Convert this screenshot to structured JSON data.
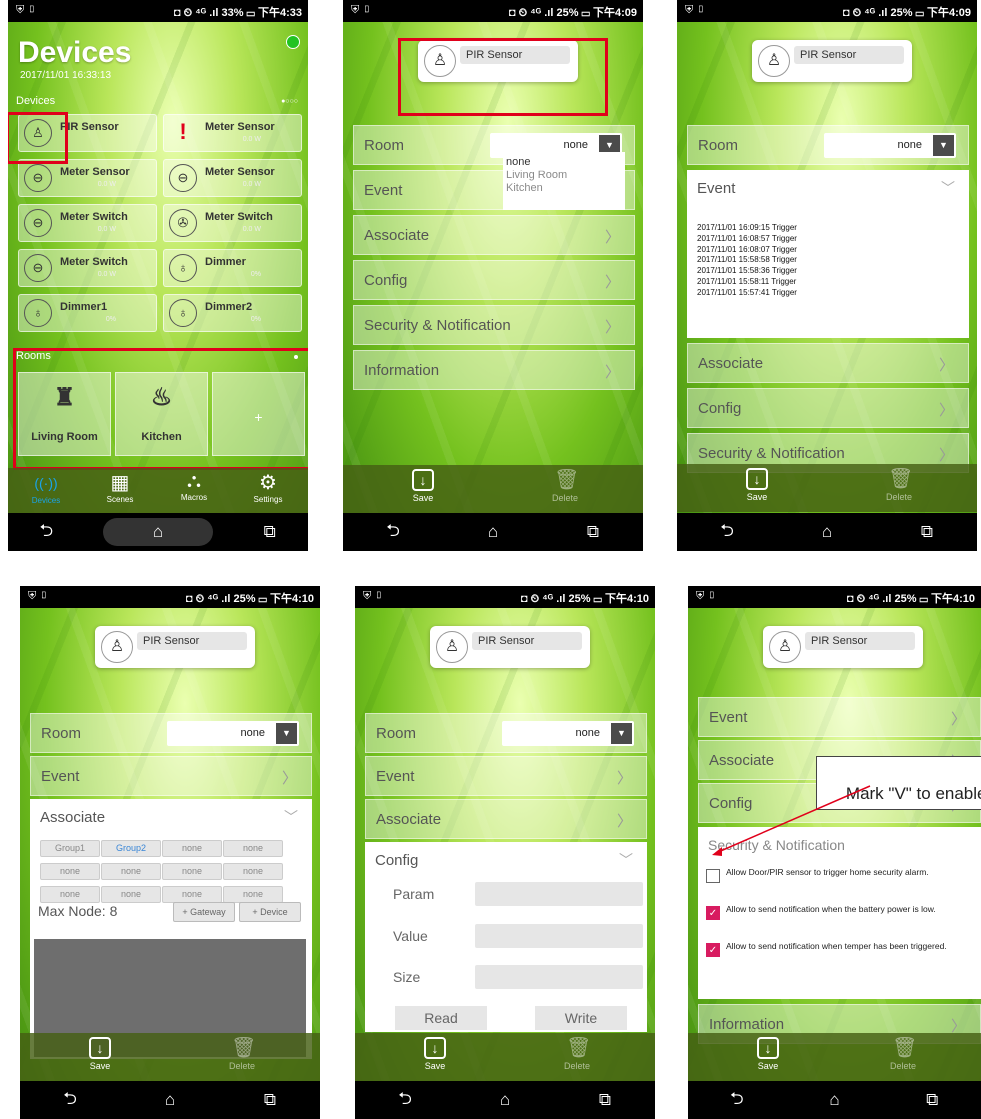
{
  "status": {
    "left_icons": "⛨ ▯",
    "s1": "◘ ⏲ ⁴ᴳ .ıl 33% ▭ 下午4:33",
    "s2": "◘ ⏲ ⁴ᴳ .ıl 25% ▭ 下午4:09",
    "s3": "◘ ⏲ ⁴ᴳ .ıl 25% ▭ 下午4:09",
    "s4": "◘ ⏲ ⁴ᴳ .ıl 25% ▭ 下午4:10",
    "s5": "◘ ⏲ ⁴ᴳ .ıl 25% ▭ 下午4:10",
    "s6": "◘ ⏲ ⁴ᴳ .ıl 25% ▭ 下午4:10"
  },
  "nav": {
    "back": "⮌",
    "home": "⌂",
    "recent": "⧉"
  },
  "screen1": {
    "title": "Devices",
    "datetime": "2017/11/01 16:33:13",
    "devices_label": "Devices",
    "page_dots": "●○○○",
    "devices": [
      {
        "name": "PIR Sensor",
        "value": "",
        "icon": "person-icon"
      },
      {
        "name": "Meter Sensor",
        "value": "0.0 W",
        "icon": "alert-icon"
      },
      {
        "name": "Meter Sensor",
        "value": "0.0 W",
        "icon": "meter-icon"
      },
      {
        "name": "Meter Sensor",
        "value": "0.0 W",
        "icon": "meter-icon"
      },
      {
        "name": "Meter Switch",
        "value": "0.0 W",
        "icon": "meter-switch-icon"
      },
      {
        "name": "Meter Switch",
        "value": "0.0 W",
        "icon": "fan-icon"
      },
      {
        "name": "Meter Switch",
        "value": "0.0 W",
        "icon": "meter-switch-icon"
      },
      {
        "name": "Dimmer",
        "value": "0%",
        "icon": "bulb-icon"
      },
      {
        "name": "Dimmer1",
        "value": "0%",
        "icon": "bulb-icon"
      },
      {
        "name": "Dimmer2",
        "value": "0%",
        "icon": "bulb-icon"
      }
    ],
    "rooms_label": "Rooms",
    "rooms": [
      {
        "name": "Living Room",
        "icon": "living-room-icon"
      },
      {
        "name": "Kitchen",
        "icon": "kitchen-icon"
      },
      {
        "name": "+",
        "icon": "add-icon"
      }
    ],
    "tabs": [
      {
        "label": "Devices",
        "icon": "wifi-person-icon"
      },
      {
        "label": "Scenes",
        "icon": "clapper-icon"
      },
      {
        "label": "Macros",
        "icon": "macro-icon"
      },
      {
        "label": "Settings",
        "icon": "gear-icon"
      }
    ]
  },
  "detail": {
    "device_name": "PIR Sensor",
    "room_label": "Room",
    "room_value": "none",
    "event_label": "Event",
    "associate_label": "Associate",
    "config_label": "Config",
    "security_label": "Security & Notification",
    "information_label": "Information",
    "save_label": "Save",
    "delete_label": "Delete"
  },
  "screen2": {
    "room_options": [
      "none",
      "Living Room",
      "Kitchen"
    ]
  },
  "screen3": {
    "events": [
      "2017/11/01 16:09:15 Trigger",
      "2017/11/01 16:08:57 Trigger",
      "2017/11/01 16:08:07 Trigger",
      "2017/11/01 15:58:58 Trigger",
      "2017/11/01 15:58:36 Trigger",
      "2017/11/01 15:58:11 Trigger",
      "2017/11/01 15:57:41 Trigger"
    ]
  },
  "screen4": {
    "groups": [
      "Group1",
      "Group2",
      "none",
      "none",
      "none",
      "none",
      "none",
      "none",
      "none",
      "none",
      "none",
      "none"
    ],
    "max_node": "Max Node: 8",
    "gateway_btn": "+ Gateway",
    "device_btn": "+ Device"
  },
  "screen5": {
    "param_label": "Param",
    "value_label": "Value",
    "size_label": "Size",
    "read_btn": "Read",
    "write_btn": "Write"
  },
  "screen6": {
    "callout": "Mark \"V\" to enable\npush notification",
    "options": [
      {
        "text": "Allow Door/PIR sensor to trigger home security alarm.",
        "checked": false
      },
      {
        "text": "Allow to send notification when the battery power is low.",
        "checked": true
      },
      {
        "text": "Allow to send notification when temper has been triggered.",
        "checked": true
      }
    ]
  },
  "colors": {
    "highlight": "#e0001b",
    "checkbox": "#d81b60",
    "group2": "#3a86d6",
    "devices_tab": "#1aa3e8"
  }
}
